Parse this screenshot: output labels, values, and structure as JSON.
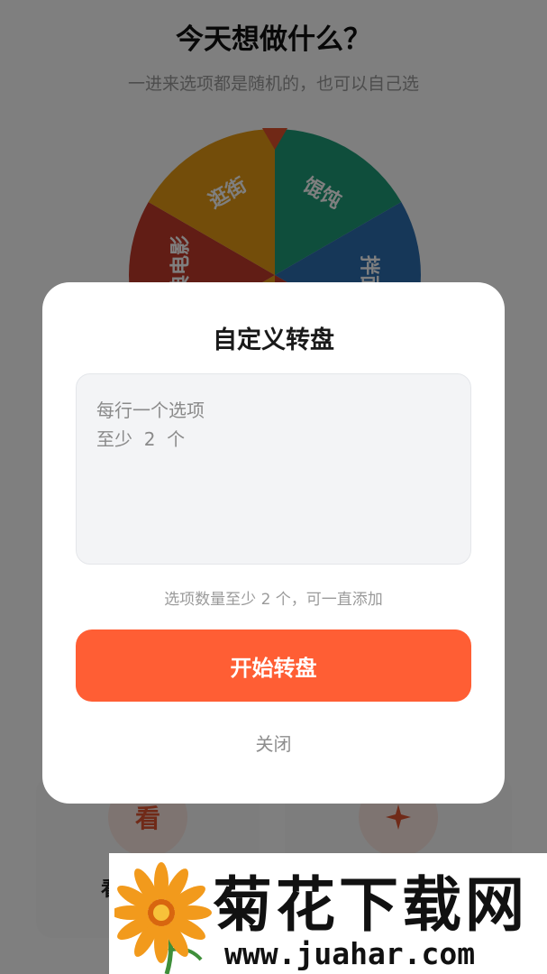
{
  "header": {
    "title": "今天想做什么？",
    "subtitle": "一进来选项都是随机的，也可以自己选"
  },
  "wheel": {
    "segments": [
      {
        "label": "馄饨",
        "color": "#1e9d78"
      },
      {
        "label": "拌面",
        "color": "#2c6fb1"
      },
      {
        "label": "",
        "color": "#c23a2b"
      },
      {
        "label": "",
        "color": "#e69a14"
      },
      {
        "label": "经典电影",
        "color": "#c23a2b"
      },
      {
        "label": "逛街",
        "color": "#e69a14"
      }
    ],
    "pointer_color": "#e0502c"
  },
  "background_cards": {
    "left_icon_text": "看",
    "left_label": "看",
    "right_icon": "sparkle-icon"
  },
  "modal": {
    "title": "自定义转盘",
    "textarea_placeholder": "每行一个选项\n至少  2  个",
    "hint": "选项数量至少 2 个，可一直添加",
    "start_button": "开始转盘",
    "close_label": "关闭"
  },
  "watermark": {
    "name": "菊花下载网",
    "url": "www.juahar.com"
  },
  "colors": {
    "accent": "#ff5e34",
    "overlay": "rgba(0,0,0,0.5)"
  }
}
